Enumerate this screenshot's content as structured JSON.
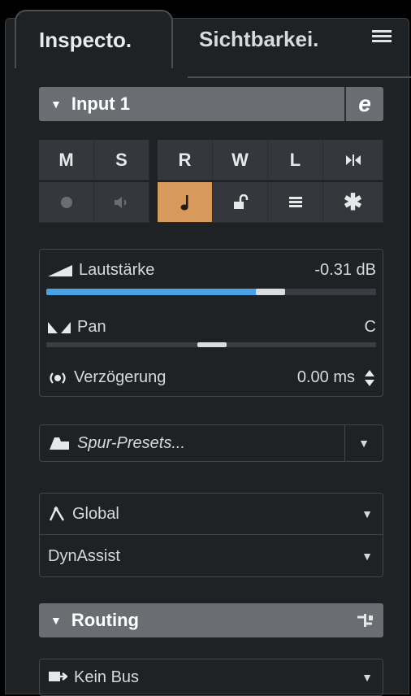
{
  "tabs": {
    "active": "Inspecto.",
    "inactive": "Sichtbarkei."
  },
  "input_section": {
    "title": "Input 1",
    "edit_icon": "e"
  },
  "buttons": {
    "row1": [
      "M",
      "S",
      "R",
      "W",
      "L"
    ],
    "row2_icons": [
      "record-icon",
      "monitor-icon",
      "note-icon",
      "lock-icon",
      "list-icon",
      "asterisk-icon"
    ]
  },
  "mixer": {
    "volume": {
      "label": "Lautstärke",
      "value": "-0.31 dB",
      "level": 0.72
    },
    "pan": {
      "label": "Pan",
      "value": "C",
      "position": 0.5
    },
    "delay": {
      "label": "Verzögerung",
      "value": "0.00 ms"
    }
  },
  "presets": {
    "label": "Spur-Presets..."
  },
  "global": {
    "label": "Global"
  },
  "dynassist": {
    "label": "DynAssist"
  },
  "routing": {
    "title": "Routing"
  },
  "bus": {
    "label": "Kein Bus"
  },
  "colors": {
    "accent": "#d89a5c",
    "volume_fill": "#4aa3e4"
  }
}
